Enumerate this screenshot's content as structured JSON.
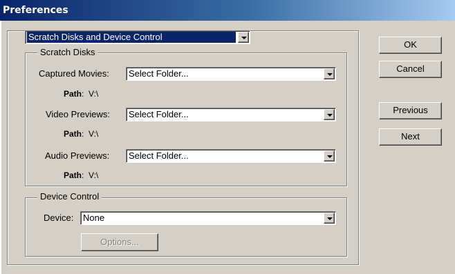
{
  "window": {
    "title": "Preferences"
  },
  "section_select": {
    "value": "Scratch Disks and Device Control"
  },
  "scratch_disks": {
    "legend": "Scratch Disks",
    "rows": [
      {
        "label": "Captured Movies:",
        "value": "Select Folder...",
        "path_label": "Path",
        "path_value": "V:\\"
      },
      {
        "label": "Video Previews:",
        "value": "Select Folder...",
        "path_label": "Path",
        "path_value": "V:\\"
      },
      {
        "label": "Audio Previews:",
        "value": "Select Folder...",
        "path_label": "Path",
        "path_value": "V:\\"
      }
    ]
  },
  "device_control": {
    "legend": "Device Control",
    "device_label": "Device:",
    "device_value": "None",
    "options_label": "Options..."
  },
  "buttons": {
    "ok": "OK",
    "cancel": "Cancel",
    "previous": "Previous",
    "next": "Next"
  }
}
